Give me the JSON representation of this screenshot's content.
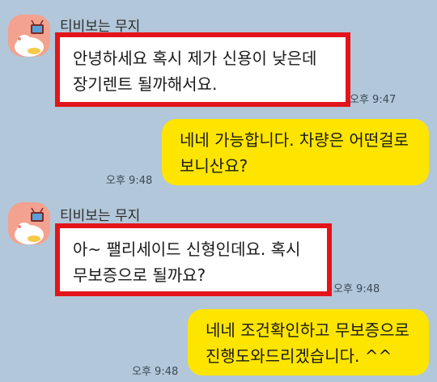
{
  "messages": [
    {
      "type": "incoming",
      "sender": "티비보는 무지",
      "lines": [
        "안녕하세요 혹시 제가 신용이 낮은데",
        "장기렌트 될까해서요."
      ],
      "time": "오후 9:47"
    },
    {
      "type": "outgoing",
      "lines": [
        "네네 가능합니다. 차량은 어떤걸로",
        "보니산요?"
      ],
      "time": "오후 9:48"
    },
    {
      "type": "incoming",
      "sender": "티비보는 무지",
      "lines": [
        "아~  팰리세이드 신형인데요. 혹시",
        "무보증으로 될까요?"
      ],
      "time": "오후 9:48"
    },
    {
      "type": "outgoing",
      "lines": [
        "네네 조건확인하고 무보증으로",
        "진행도와드리겠습니다. ^^"
      ],
      "time": "오후 9:48"
    }
  ],
  "colors": {
    "background": "#b2c7d9",
    "outgoing_bubble": "#fee500",
    "incoming_bubble": "#ffffff",
    "highlight_box": "#e4141b"
  }
}
